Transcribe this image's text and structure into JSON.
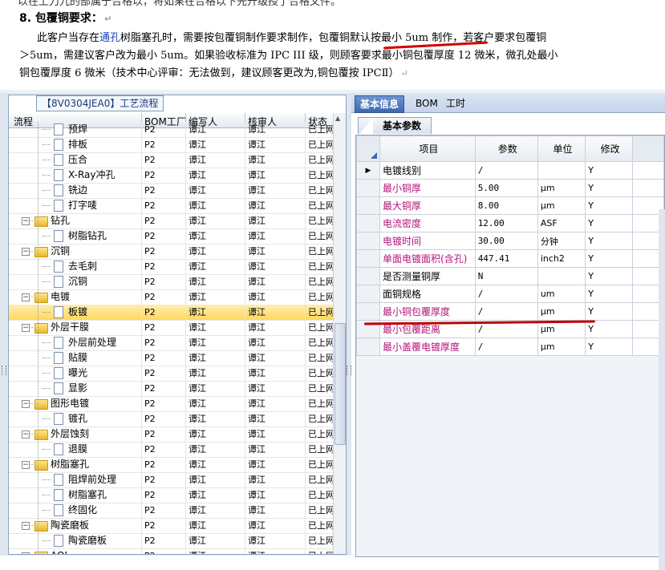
{
  "doc": {
    "cut_line": "以在上刀九的部属于合格以，将如果在合格以下先升级授了合格文件。",
    "section_title": "8. 包覆铜要求：",
    "line1_pre": "此客户当存在",
    "line1_hl": "通孔",
    "line1_post": "树脂塞孔时，需要按包覆铜制作要求制作，包覆铜默认按最小 5um 制作，若客户要求包覆铜",
    "line2": "＞5um，需建议客户改为最小 5um。如果验收标准为 IPC III 级，则顾客要求最小铜包覆厚度 12 微米，微孔处最小",
    "line3": "铜包覆厚度 6 微米（技术中心评审：无法做到，建议顾客更改为,铜包覆按 IPCⅡ）"
  },
  "left": {
    "tab_title": "【8V0304JEA0】工艺流程",
    "columns": [
      "流程",
      "BOM工厂",
      "编写人",
      "核审人",
      "状态"
    ],
    "rows": [
      {
        "name": "预焊",
        "level": 2,
        "type": "doc",
        "bom": "P2",
        "writer": "谭江",
        "reviewer": "谭江",
        "status": "已上网"
      },
      {
        "name": "排板",
        "level": 2,
        "type": "doc",
        "bom": "P2",
        "writer": "谭江",
        "reviewer": "谭江",
        "status": "已上网"
      },
      {
        "name": "压合",
        "level": 2,
        "type": "doc",
        "bom": "P2",
        "writer": "谭江",
        "reviewer": "谭江",
        "status": "已上网"
      },
      {
        "name": "X-Ray冲孔",
        "level": 2,
        "type": "doc",
        "bom": "P2",
        "writer": "谭江",
        "reviewer": "谭江",
        "status": "已上网"
      },
      {
        "name": "铣边",
        "level": 2,
        "type": "doc",
        "bom": "P2",
        "writer": "谭江",
        "reviewer": "谭江",
        "status": "已上网"
      },
      {
        "name": "打字唛",
        "level": 2,
        "type": "doc",
        "bom": "P2",
        "writer": "谭江",
        "reviewer": "谭江",
        "status": "已上网"
      },
      {
        "name": "钻孔",
        "level": 1,
        "type": "folder",
        "bom": "P2",
        "writer": "谭江",
        "reviewer": "谭江",
        "status": "已上网"
      },
      {
        "name": "树脂钻孔",
        "level": 2,
        "type": "doc",
        "bom": "P2",
        "writer": "谭江",
        "reviewer": "谭江",
        "status": "已上网"
      },
      {
        "name": "沉铜",
        "level": 1,
        "type": "folder",
        "bom": "P2",
        "writer": "谭江",
        "reviewer": "谭江",
        "status": "已上网"
      },
      {
        "name": "去毛刺",
        "level": 2,
        "type": "doc",
        "bom": "P2",
        "writer": "谭江",
        "reviewer": "谭江",
        "status": "已上网"
      },
      {
        "name": "沉铜",
        "level": 2,
        "type": "doc",
        "bom": "P2",
        "writer": "谭江",
        "reviewer": "谭江",
        "status": "已上网"
      },
      {
        "name": "电镀",
        "level": 1,
        "type": "folder",
        "bom": "P2",
        "writer": "谭江",
        "reviewer": "谭江",
        "status": "已上网"
      },
      {
        "name": "板镀",
        "level": 2,
        "type": "doc",
        "bom": "P2",
        "writer": "谭江",
        "reviewer": "谭江",
        "status": "已上网",
        "selected": true
      },
      {
        "name": "外层干膜",
        "level": 1,
        "type": "folder",
        "bom": "P2",
        "writer": "谭江",
        "reviewer": "谭江",
        "status": "已上网"
      },
      {
        "name": "外层前处理",
        "level": 2,
        "type": "doc",
        "bom": "P2",
        "writer": "谭江",
        "reviewer": "谭江",
        "status": "已上网"
      },
      {
        "name": "贴膜",
        "level": 2,
        "type": "doc",
        "bom": "P2",
        "writer": "谭江",
        "reviewer": "谭江",
        "status": "已上网"
      },
      {
        "name": "曝光",
        "level": 2,
        "type": "doc",
        "bom": "P2",
        "writer": "谭江",
        "reviewer": "谭江",
        "status": "已上网"
      },
      {
        "name": "显影",
        "level": 2,
        "type": "doc",
        "bom": "P2",
        "writer": "谭江",
        "reviewer": "谭江",
        "status": "已上网"
      },
      {
        "name": "图形电镀",
        "level": 1,
        "type": "folder",
        "bom": "P2",
        "writer": "谭江",
        "reviewer": "谭江",
        "status": "已上网"
      },
      {
        "name": "镀孔",
        "level": 2,
        "type": "doc",
        "bom": "P2",
        "writer": "谭江",
        "reviewer": "谭江",
        "status": "已上网"
      },
      {
        "name": "外层蚀刻",
        "level": 1,
        "type": "folder",
        "bom": "P2",
        "writer": "谭江",
        "reviewer": "谭江",
        "status": "已上网"
      },
      {
        "name": "退膜",
        "level": 2,
        "type": "doc",
        "bom": "P2",
        "writer": "谭江",
        "reviewer": "谭江",
        "status": "已上网"
      },
      {
        "name": "树脂塞孔",
        "level": 1,
        "type": "folder",
        "bom": "P2",
        "writer": "谭江",
        "reviewer": "谭江",
        "status": "已上网"
      },
      {
        "name": "阻焊前处理",
        "level": 2,
        "type": "doc",
        "bom": "P2",
        "writer": "谭江",
        "reviewer": "谭江",
        "status": "已上网"
      },
      {
        "name": "树脂塞孔",
        "level": 2,
        "type": "doc",
        "bom": "P2",
        "writer": "谭江",
        "reviewer": "谭江",
        "status": "已上网"
      },
      {
        "name": "终固化",
        "level": 2,
        "type": "doc",
        "bom": "P2",
        "writer": "谭江",
        "reviewer": "谭江",
        "status": "已上网"
      },
      {
        "name": "陶瓷磨板",
        "level": 1,
        "type": "folder",
        "bom": "P2",
        "writer": "谭江",
        "reviewer": "谭江",
        "status": "已上网"
      },
      {
        "name": "陶瓷磨板",
        "level": 2,
        "type": "doc",
        "bom": "P2",
        "writer": "谭江",
        "reviewer": "谭江",
        "status": "已上网"
      },
      {
        "name": "AOI",
        "level": 1,
        "type": "folder",
        "bom": "P2",
        "writer": "谭江",
        "reviewer": "谭江",
        "status": "已上网"
      }
    ]
  },
  "right": {
    "tabs": [
      "基本信息",
      "BOM",
      "工时"
    ],
    "active_tab": 0,
    "subtab": "基本参数",
    "columns": [
      "项目",
      "参数",
      "单位",
      "修改"
    ],
    "rows": [
      {
        "item": "电镀线别",
        "value": "/",
        "unit": "",
        "modify": "Y",
        "magenta": false,
        "current": true
      },
      {
        "item": "最小铜厚",
        "value": "5.00",
        "unit": "μm",
        "modify": "Y",
        "magenta": true
      },
      {
        "item": "最大铜厚",
        "value": "8.00",
        "unit": "μm",
        "modify": "Y",
        "magenta": true
      },
      {
        "item": "电流密度",
        "value": "12.00",
        "unit": "ASF",
        "modify": "Y",
        "magenta": true
      },
      {
        "item": "电镀时间",
        "value": "30.00",
        "unit": "分钟",
        "modify": "Y",
        "magenta": true
      },
      {
        "item": "单面电镀面积(含孔)",
        "value": "447.41",
        "unit": "inch2",
        "modify": "Y",
        "magenta": true
      },
      {
        "item": "是否测量铜厚",
        "value": "N",
        "unit": "",
        "modify": "Y",
        "magenta": false
      },
      {
        "item": "面铜规格",
        "value": "/",
        "unit": "um",
        "modify": "Y",
        "magenta": false
      },
      {
        "item": "最小铜包覆厚度",
        "value": "/",
        "unit": "μm",
        "modify": "Y",
        "magenta": true
      },
      {
        "item": "最小包覆距离",
        "value": "/",
        "unit": "μm",
        "modify": "Y",
        "magenta": true
      },
      {
        "item": "最小盖覆电镀厚度",
        "value": "/",
        "unit": "μm",
        "modify": "Y",
        "magenta": true
      }
    ]
  },
  "colors": {
    "accent": "#3c67b0",
    "magenta": "#b4147a",
    "selected": "#ffd85c",
    "annotation": "#d10000"
  }
}
